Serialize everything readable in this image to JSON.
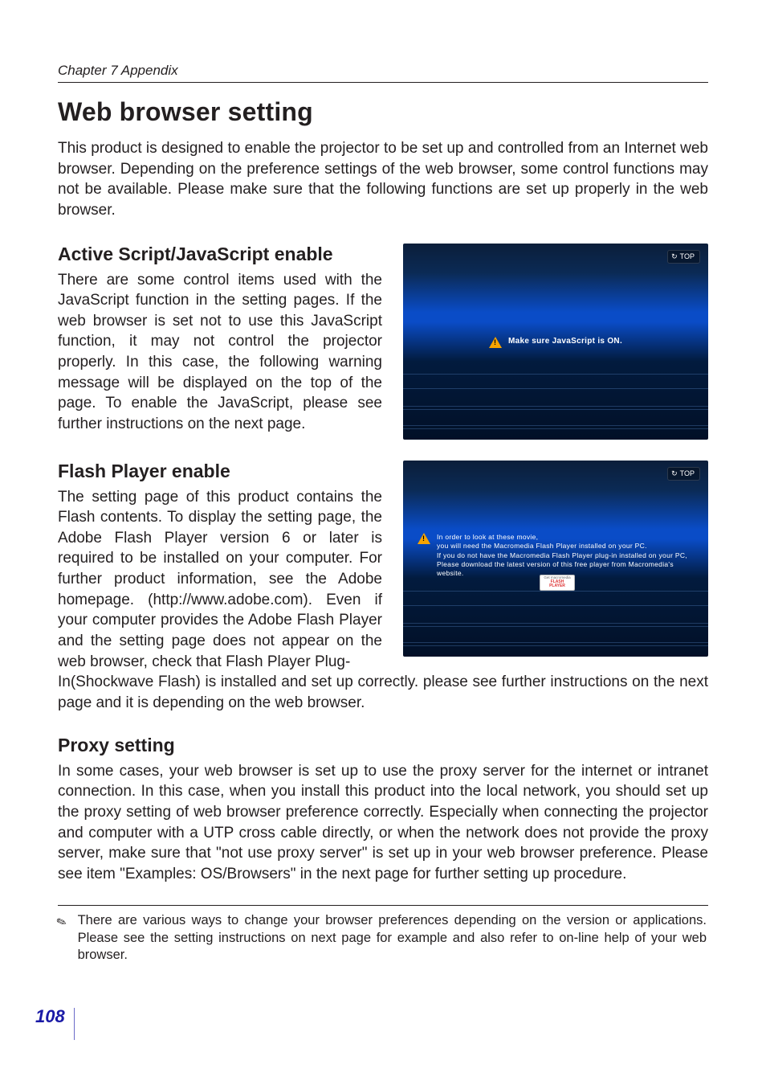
{
  "running_head": "Chapter 7 Appendix",
  "h1": "Web browser setting",
  "intro": "This product is designed to enable the projector to be set up and controlled from an Internet web browser. Depending on the preference settings of the web browser, some control functions may not be available. Please make sure that the following functions are set up properly in the web browser.",
  "sections": {
    "js": {
      "title": "Active Script/JavaScript enable",
      "body": "There are some control items used with the JavaScript function in the setting pages. If the web browser is set not to use this JavaScript function, it may not control the projector properly. In this case, the following warning message will be displayed on the top of the page. To enable the JavaScript, please see further instructions on the next page."
    },
    "flash": {
      "title": "Flash Player enable",
      "body_left": "The setting page of this product contains the Flash contents. To display the setting page, the Adobe Flash Player version 6 or later is required to be installed on your computer. For further product information, see the Adobe homepage. (http://www.adobe.com). Even if your computer provides the Adobe Flash Player and the setting page does not appear on the web browser, check that Flash Player Plug-",
      "body_below": "In(Shockwave Flash) is installed and set up correctly. please see further instructions on the next page and it is depending on the web browser."
    },
    "proxy": {
      "title": "Proxy setting",
      "body": "In some cases, your web browser is set up to use the proxy server for the internet or intranet connection. In this case, when you install this product into the local network, you should set up the proxy setting of web browser preference correctly. Especially when connecting the projector and computer with a UTP cross cable directly, or when the network does not provide the proxy server, make sure that \"not use proxy server\" is set up in your web browser preference.  Please see item \"Examples: OS/Browsers\" in the next page for further setting up procedure."
    }
  },
  "figures": {
    "top_label": "TOP",
    "refresh_glyph": "↻",
    "js_warning": "Make sure JavaScript is ON.",
    "flash_warning": "In order to look at these movie,\nyou will need the Macromedia Flash Player installed on your PC.\nIf you do not have the Macromedia Flash Player plug-in installed on your PC,\nPlease download the latest version of this free player from Macromedia's website.",
    "getflash_top": "Get macromedia",
    "getflash_mid": "FLASH",
    "getflash_bot": "PLAYER"
  },
  "footnote": "There are various ways to change your browser preferences depending on the version or applications. Please see the setting instructions on next page for example and also refer to on-line help of your web browser.",
  "page_number": "108"
}
